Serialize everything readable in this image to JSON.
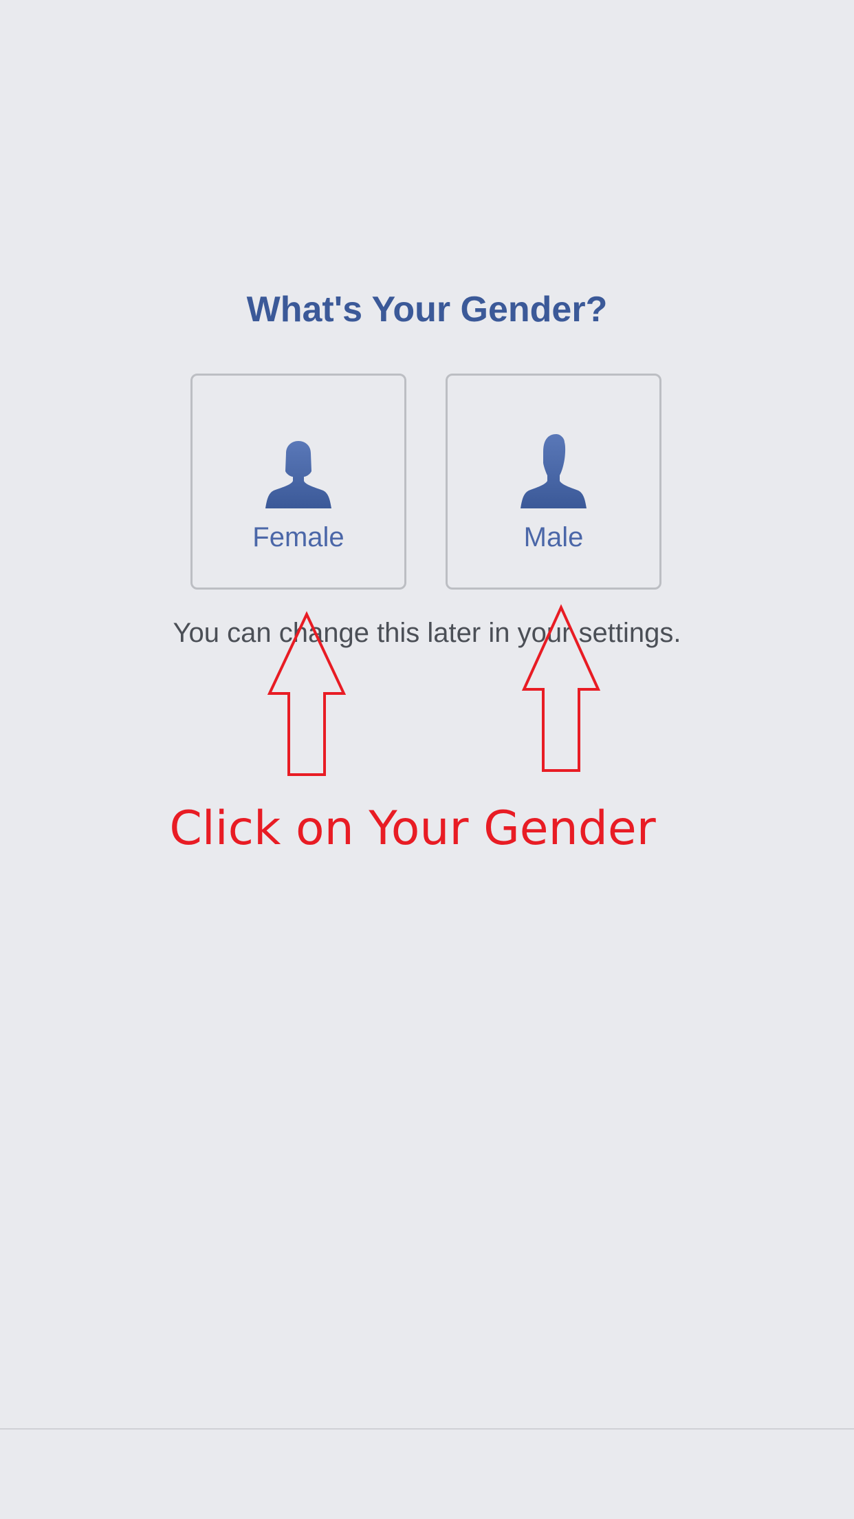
{
  "page": {
    "title": "What's Your Gender?",
    "hint": "You can change this later in your settings."
  },
  "options": {
    "female": {
      "label": "Female",
      "icon": "female-silhouette-icon"
    },
    "male": {
      "label": "Male",
      "icon": "male-silhouette-icon"
    }
  },
  "annotation": {
    "text": "Click on Your Gender",
    "color": "#e81c24"
  },
  "colors": {
    "background": "#e9eaee",
    "brand": "#3b5998",
    "label": "#4b67a8",
    "hint_text": "#4b4f56",
    "border": "#bcbec3"
  }
}
